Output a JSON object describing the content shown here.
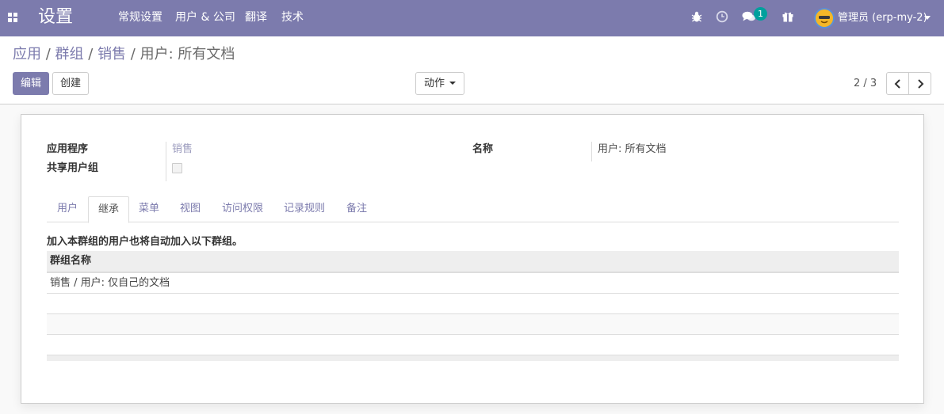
{
  "navbar": {
    "brand": "设置",
    "menu": [
      "常规设置",
      "用户 & 公司",
      "翻译",
      "技术"
    ],
    "message_count": "1",
    "user": "管理员 (erp-my-2)",
    "icons": [
      "apps-icon",
      "bug-icon",
      "clock-icon",
      "chat-icon",
      "gift-icon",
      "avatar"
    ]
  },
  "breadcrumb": {
    "items": [
      "应用",
      "群组",
      "销售"
    ],
    "separator": "/",
    "current": "用户: 所有文档"
  },
  "buttons": {
    "edit": "编辑",
    "create": "创建",
    "action": "动作"
  },
  "pager": {
    "value": "2 / 3"
  },
  "form": {
    "application_label": "应用程序",
    "application_value": "销售",
    "shared_label": "共享用户组",
    "shared_value": false,
    "name_label": "名称",
    "name_value": "用户: 所有文档"
  },
  "tabs": {
    "items": [
      "用户",
      "继承",
      "菜单",
      "视图",
      "访问权限",
      "记录规则",
      "备注"
    ],
    "active": "继承"
  },
  "inherited": {
    "help": "加入本群组的用户也将自动加入以下群组。",
    "column": "群组名称",
    "rows": [
      "销售 / 用户: 仅自己的文档"
    ]
  },
  "colors": {
    "brand": "#7c7bad",
    "badge": "#00a09d"
  }
}
